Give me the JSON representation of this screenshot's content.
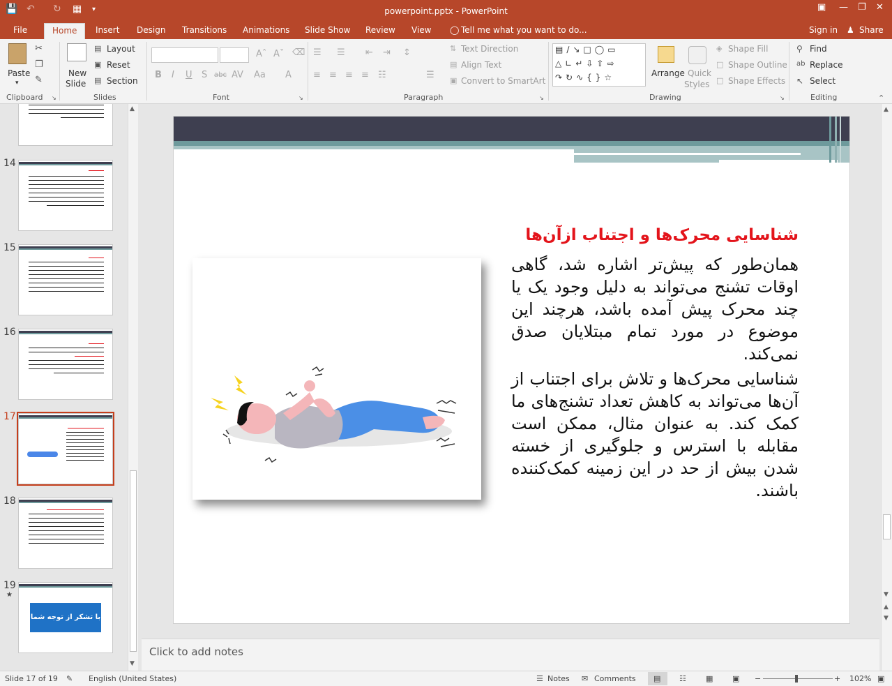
{
  "app": {
    "doc_title": "powerpoint.pptx - PowerPoint"
  },
  "tabs": [
    "File",
    "Home",
    "Insert",
    "Design",
    "Transitions",
    "Animations",
    "Slide Show",
    "Review",
    "View"
  ],
  "tell_me": "Tell me what you want to do...",
  "sign_in": "Sign in",
  "share": "Share",
  "ribbon": {
    "clipboard": {
      "paste": "Paste",
      "label": "Clipboard"
    },
    "slides": {
      "new_slide": "New",
      "new_slide2": "Slide",
      "layout": "Layout",
      "reset": "Reset",
      "section": "Section",
      "label": "Slides"
    },
    "font": {
      "label": "Font",
      "bold": "B",
      "italic": "I",
      "underline": "U",
      "shadow": "S",
      "strike": "abc",
      "spacing": "AV",
      "case": "Aa",
      "color": "A"
    },
    "paragraph": {
      "label": "Paragraph",
      "text_direction": "Text Direction",
      "align_text": "Align Text",
      "convert_smartart": "Convert to SmartArt"
    },
    "drawing": {
      "label": "Drawing",
      "arrange": "Arrange",
      "quick_styles": "Quick",
      "quick_styles2": "Styles",
      "shape_fill": "Shape Fill",
      "shape_outline": "Shape Outline",
      "shape_effects": "Shape Effects"
    },
    "editing": {
      "label": "Editing",
      "find": "Find",
      "replace": "Replace",
      "select": "Select"
    }
  },
  "thumbs": [
    {
      "num": "14"
    },
    {
      "num": "15"
    },
    {
      "num": "16"
    },
    {
      "num": "17"
    },
    {
      "num": "18"
    },
    {
      "num": "19",
      "star": "★",
      "button": "با تشکر از توجه شما"
    }
  ],
  "slide": {
    "title": "شناسایی محرک‌ها و اجتناب ازآن‌ها",
    "para1": "همان‌طور که پیش‌تر اشاره شد، گاهی اوقات تشنج می‌تواند به دلیل وجود یک یا چند محرک پیش آمده باشد، هرچند این موضوع در مورد تمام مبتلایان صدق نمی‌کند.",
    "para2": "شناسایی محرک‌ها و تلاش برای اجتناب از آن‌ها می‌تواند به کاهش تعداد تشنج‌های ما کمک کند. به عنوان مثال، ممکن است مقابله با استرس و جلوگیری از خسته شدن بیش از حد در این زمینه کمک‌کننده باشند."
  },
  "notes_placeholder": "Click to add notes",
  "status": {
    "slide": "Slide 17 of 19",
    "lang": "English (United States)",
    "notes": "Notes",
    "comments": "Comments",
    "zoom": "102%"
  },
  "colors": {
    "accent": "#b7472a",
    "slide_bar": "#3e3f50",
    "slide_teal": "#6e9a9c",
    "title_red": "#e3141b"
  }
}
